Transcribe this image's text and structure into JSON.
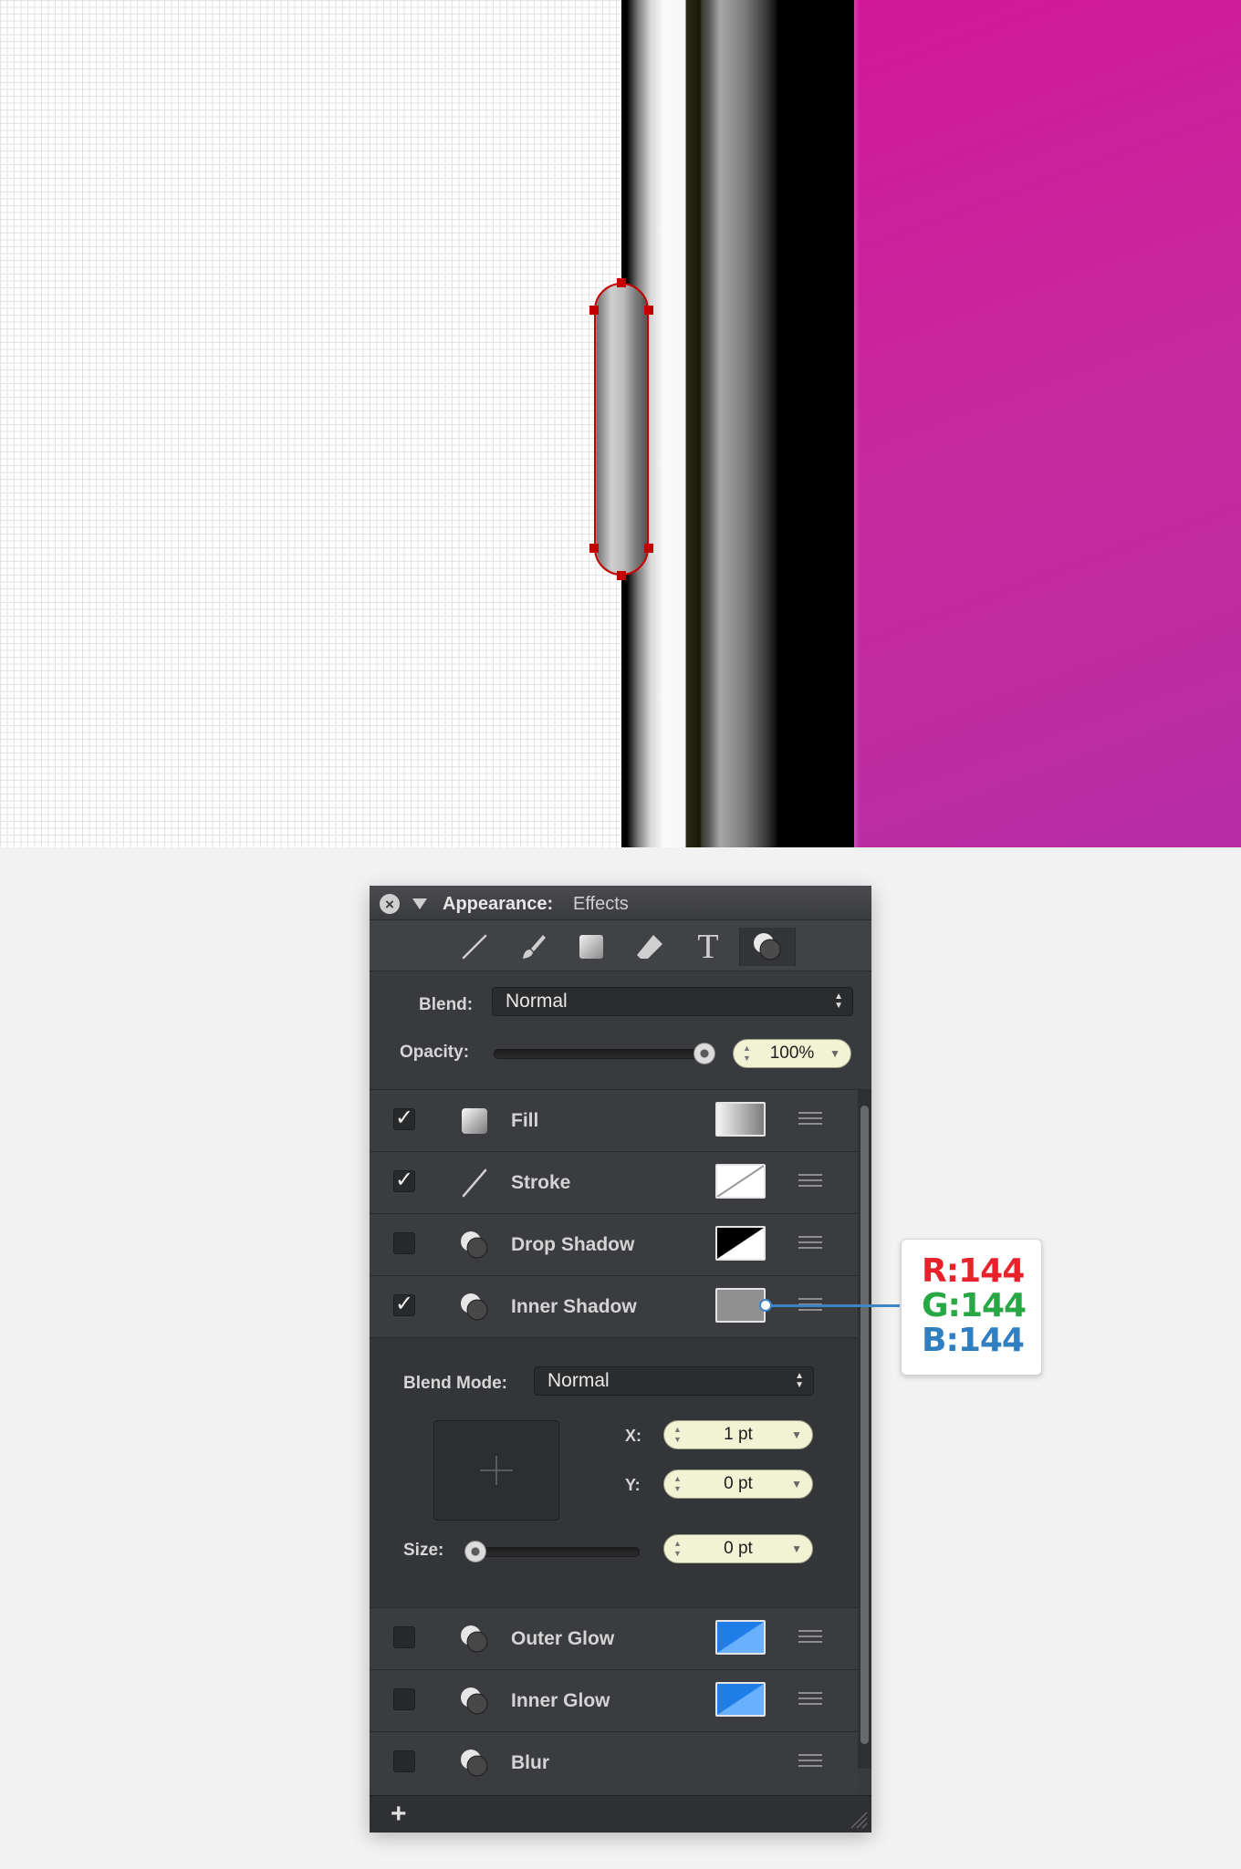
{
  "panel": {
    "title": "Appearance:",
    "subtitle": "Effects",
    "blend_label": "Blend:",
    "blend_value": "Normal",
    "opacity_label": "Opacity:",
    "opacity_value": "100%",
    "opacity_level": 1.0
  },
  "toolbar": {
    "tools": [
      "line-tool-icon",
      "brush-tool-icon",
      "shape-tool-icon",
      "eraser-tool-icon",
      "text-tool-icon",
      "effects-tool-icon"
    ]
  },
  "effects": [
    {
      "label": "Fill",
      "checked": true,
      "swatch": "gradient-gray"
    },
    {
      "label": "Stroke",
      "checked": true,
      "swatch": "white-slash"
    },
    {
      "label": "Drop Shadow",
      "checked": false,
      "swatch": "black-white"
    },
    {
      "label": "Inner Shadow",
      "checked": true,
      "swatch": "#909090"
    },
    {
      "label": "Outer Glow",
      "checked": false,
      "swatch": "#2f8cf0"
    },
    {
      "label": "Inner Glow",
      "checked": false,
      "swatch": "#2f8cf0"
    },
    {
      "label": "Blur",
      "checked": false,
      "swatch": ""
    }
  ],
  "inner_shadow": {
    "blend_mode_label": "Blend Mode:",
    "blend_mode_value": "Normal",
    "x_label": "X:",
    "x_value": "1 pt",
    "y_label": "Y:",
    "y_value": "0 pt",
    "size_label": "Size:",
    "size_value": "0 pt",
    "size_level": 0.0
  },
  "callout": {
    "r": "R:144",
    "g": "G:144",
    "b": "B:144",
    "colors": {
      "r": "#e8222b",
      "g": "#27a844",
      "b": "#2f7fc1"
    }
  },
  "canvas": {
    "accent_magenta": "#cc1a9c",
    "selection_color": "#c40000"
  }
}
